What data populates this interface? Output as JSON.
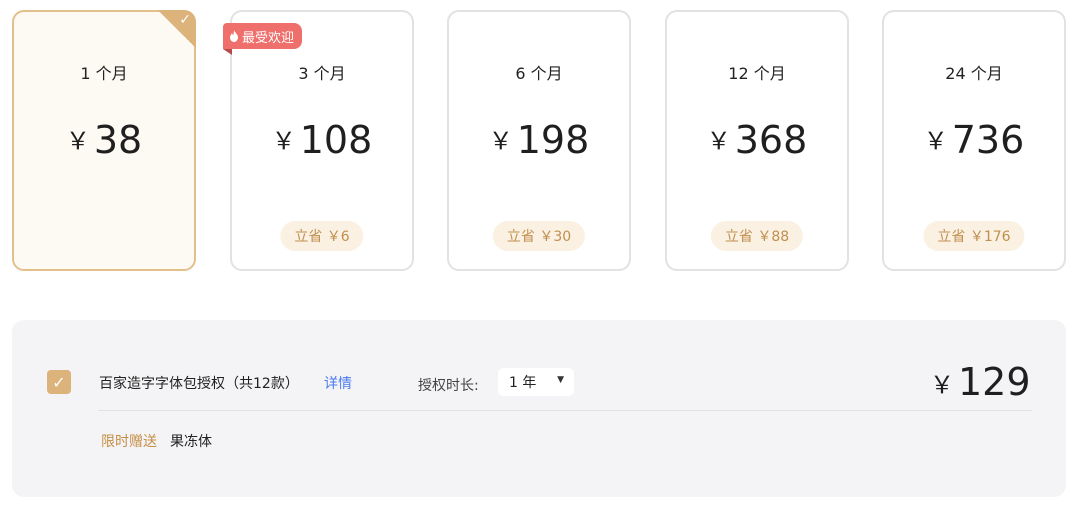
{
  "currency": "￥",
  "plans": [
    {
      "duration": "1 个月",
      "price": "38"
    },
    {
      "duration": "3 个月",
      "price": "108",
      "save": "立省 ￥6",
      "badge": "最受欢迎"
    },
    {
      "duration": "6 个月",
      "price": "198",
      "save": "立省 ￥30"
    },
    {
      "duration": "12 个月",
      "price": "368",
      "save": "立省 ￥88"
    },
    {
      "duration": "24 个月",
      "price": "736",
      "save": "立省 ￥176"
    }
  ],
  "selected_plan": "1 个月",
  "addon": {
    "name": "百家造字字体包授权（共12款）",
    "details_link": "详情",
    "duration_label": "授权时长:",
    "duration_value": "1 年",
    "price": "129",
    "gift_label": "限时赠送",
    "gift_item": "果冻体"
  },
  "colors": {
    "accent_gold": "#dcb37a",
    "badge_red": "#ee6f6c",
    "link_blue": "#4a7bf0",
    "save_text": "#c08f4e"
  },
  "icons": {
    "selected_corner": "checkmark-icon",
    "badge": "flame-icon",
    "dropdown": "caret-down-icon",
    "checkbox": "checkmark-icon"
  }
}
